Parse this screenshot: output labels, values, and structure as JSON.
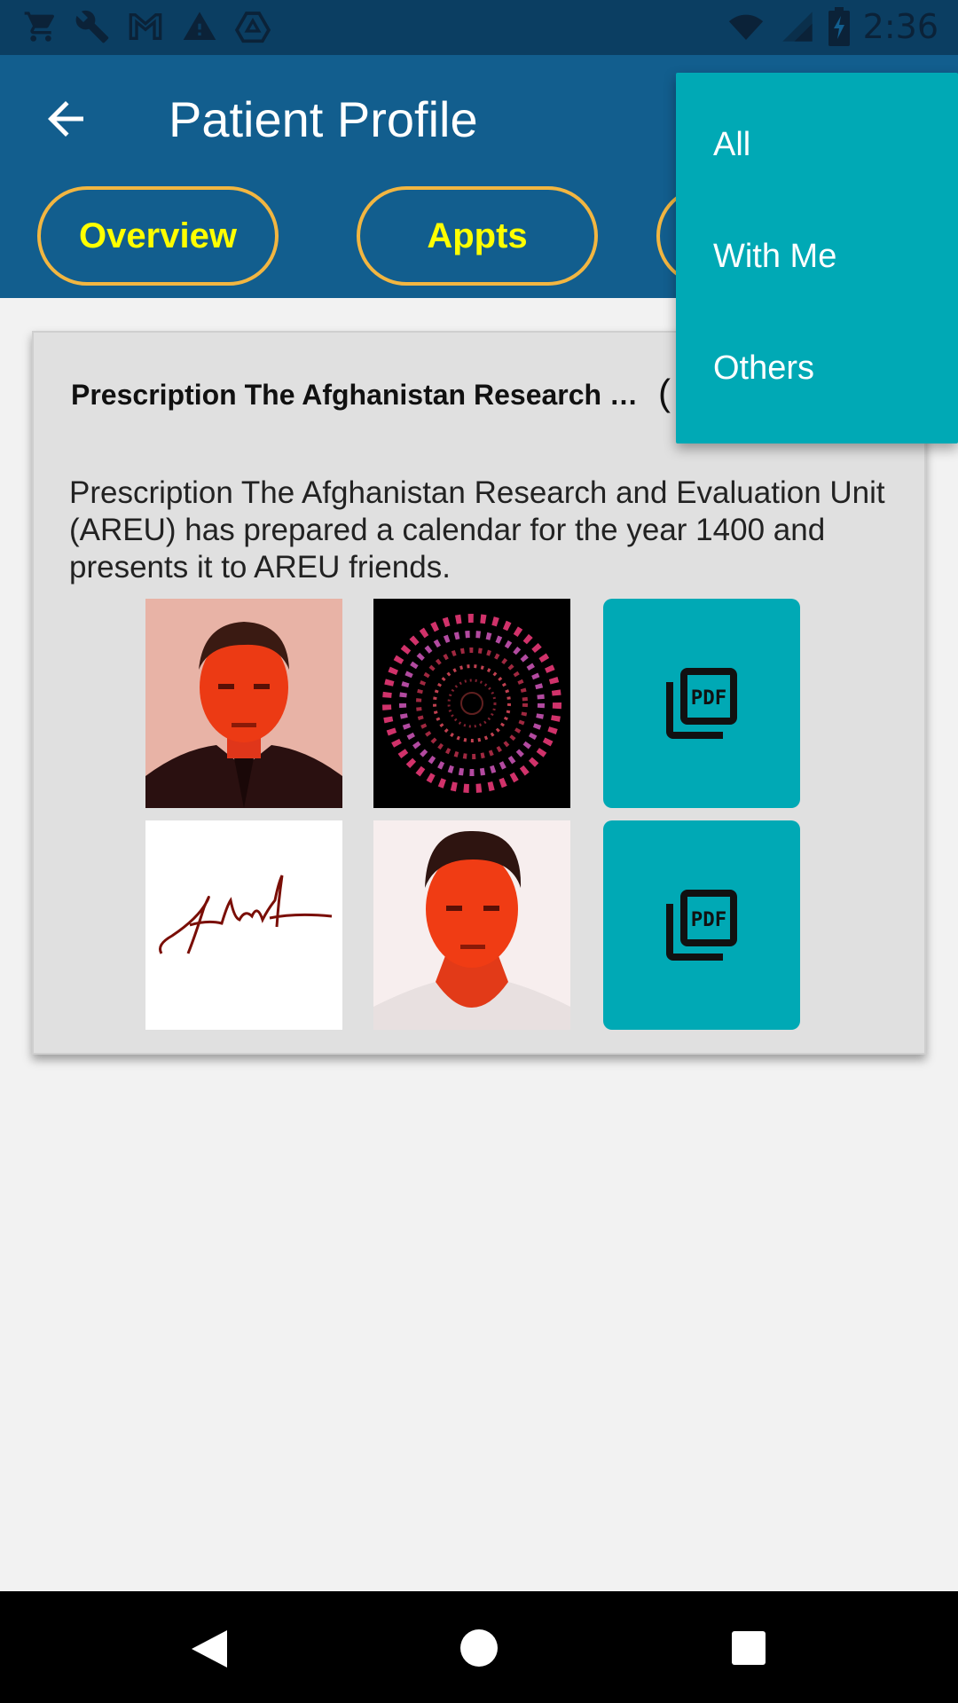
{
  "status_bar": {
    "time": "2:36",
    "left_icons": [
      "cart-icon",
      "wrench-icon",
      "gmail-icon",
      "warning-icon",
      "drive-icon"
    ],
    "right_icons": [
      "wifi-icon",
      "signal-icon",
      "battery-icon"
    ]
  },
  "header": {
    "title": "Patient Profile",
    "back_icon": "back-arrow-icon"
  },
  "tabs": [
    {
      "label": "Overview"
    },
    {
      "label": "Appts"
    }
  ],
  "card": {
    "title": "Prescription The Afghanistan Research …",
    "extra": "(",
    "body": "Prescription The Afghanistan Research and Evaluation Unit (AREU) has prepared a calendar for the year 1400 and presents it to AREU friends."
  },
  "attachments": [
    {
      "type": "image",
      "name": "photo-man-suit"
    },
    {
      "type": "image",
      "name": "spiral-digits"
    },
    {
      "type": "pdf",
      "name": "pdf-icon"
    },
    {
      "type": "image",
      "name": "signature"
    },
    {
      "type": "image",
      "name": "photo-young-man"
    },
    {
      "type": "pdf",
      "name": "pdf-icon"
    }
  ],
  "dropdown": {
    "items": [
      {
        "label": "All"
      },
      {
        "label": "With Me"
      },
      {
        "label": "Others"
      }
    ]
  },
  "colors": {
    "status_bar": "#0b3e62",
    "app_bar": "#125e8e",
    "tab_border": "#f2b641",
    "tab_text": "#ffff00",
    "menu_bg": "#00a9b5",
    "pdf_tile": "#00a9b5"
  }
}
